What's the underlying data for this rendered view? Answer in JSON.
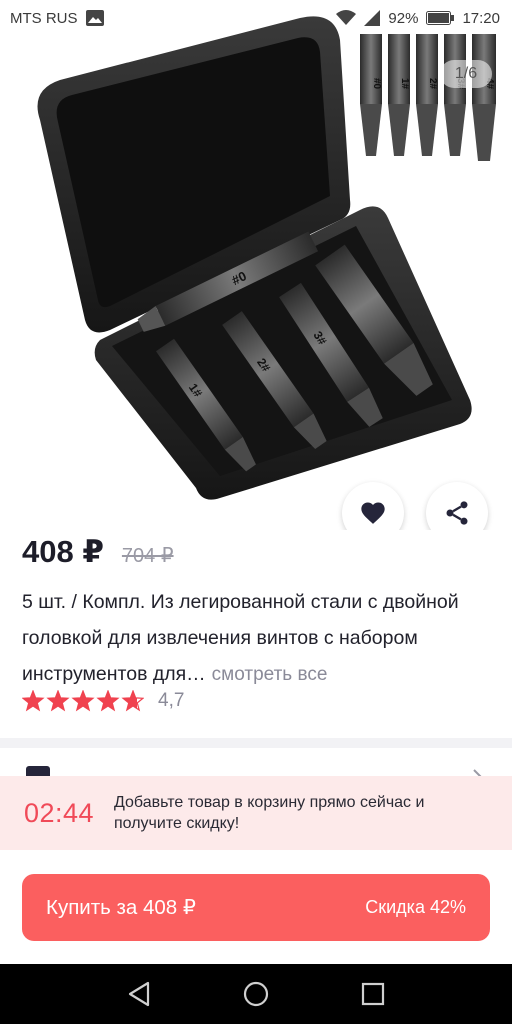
{
  "status_bar": {
    "carrier": "MTS RUS",
    "battery": "92%",
    "time": "17:20"
  },
  "gallery": {
    "counter": "1/6",
    "thumb_labels": [
      "#0",
      "1#",
      "2#",
      "3#",
      "4#"
    ]
  },
  "product": {
    "price": "408 ₽",
    "old_price": "704 ₽",
    "title": "5 шт. / Компл. Из легированной стали с двойной головкой для извлечения винтов с набором инструментов для…",
    "see_all": "смотреть все",
    "rating": 4.7,
    "rating_label": "4,7",
    "bit_labels": [
      "#0",
      "1#",
      "2#",
      "3#"
    ]
  },
  "promo": {
    "timer": "02:44",
    "text": "Добавьте товар в корзину прямо сейчас и получите скидку!"
  },
  "buy": {
    "label": "Купить за 408 ₽",
    "discount": "Скидка 42%"
  },
  "colors": {
    "accent": "#fb5f5f",
    "timer": "#f04a58",
    "promo_bg": "#fdeaea",
    "price": "#1d1d29",
    "star": "#f0424f"
  },
  "icons": {
    "back": "arrow-left-icon",
    "favorite": "heart-icon",
    "share": "share-icon",
    "nav_back": "triangle-back-icon",
    "nav_home": "circle-home-icon",
    "nav_recent": "square-recent-icon"
  }
}
